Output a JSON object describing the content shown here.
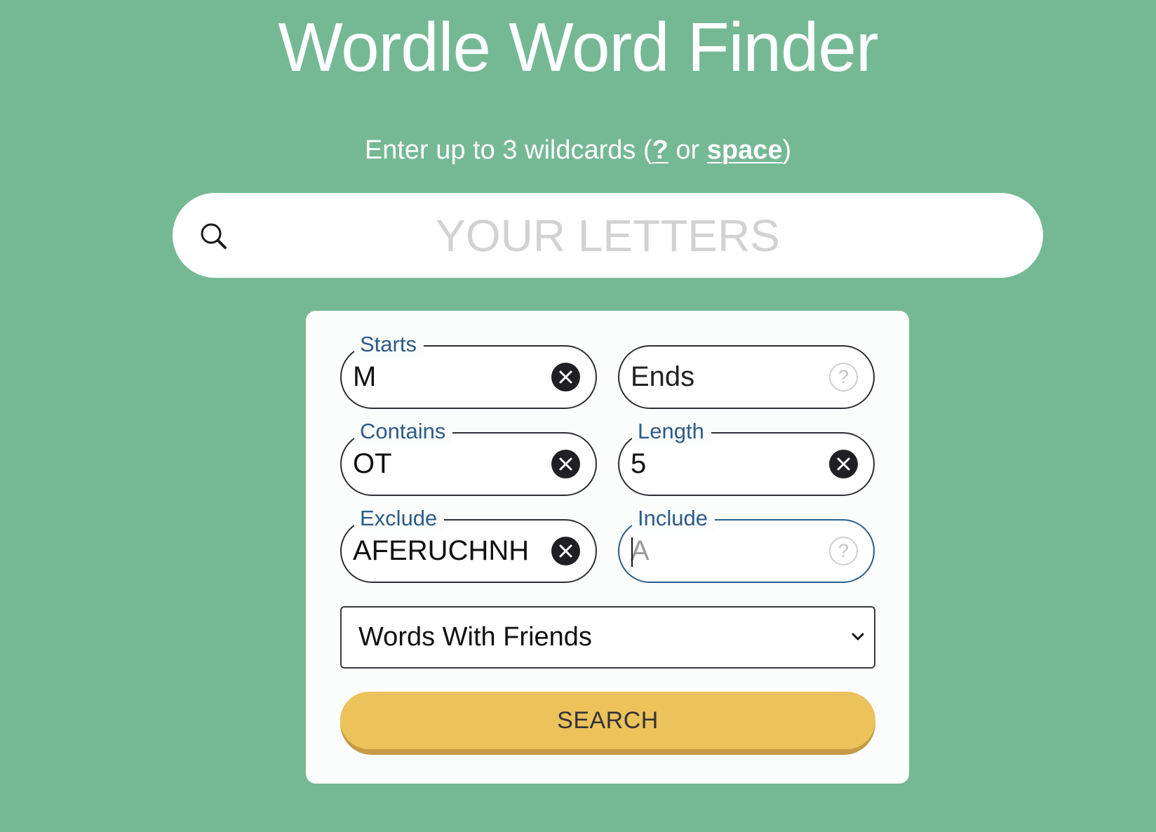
{
  "header": {
    "title": "Wordle Word Finder",
    "subtitle_prefix": "Enter up to 3 wildcards (",
    "subtitle_link_question": "?",
    "subtitle_middle": " or ",
    "subtitle_link_space": "space",
    "subtitle_suffix": ")"
  },
  "search": {
    "icon": "search-icon",
    "placeholder": "YOUR LETTERS",
    "value": ""
  },
  "filters": {
    "starts": {
      "label": "Starts",
      "value": "M",
      "placeholder": "",
      "action_icon": "clear-icon"
    },
    "ends": {
      "label": "",
      "value": "",
      "placeholder": "Ends",
      "action_icon": "help-icon"
    },
    "contains": {
      "label": "Contains",
      "value": "OT",
      "placeholder": "",
      "action_icon": "clear-icon"
    },
    "length": {
      "label": "Length",
      "value": "5",
      "placeholder": "",
      "action_icon": "clear-icon"
    },
    "exclude": {
      "label": "Exclude",
      "value": "AFERUCHNH",
      "placeholder": "",
      "action_icon": "clear-icon"
    },
    "include": {
      "label": "Include",
      "value": "",
      "placeholder": "A",
      "action_icon": "help-icon",
      "focused": true
    }
  },
  "help_glyph": "?",
  "dictionary_select": {
    "selected": "Words With Friends"
  },
  "search_button": {
    "label": "SEARCH"
  },
  "colors": {
    "background": "#75B994",
    "panel": "#FBFCFC",
    "label_blue": "#2B5C8A",
    "button_yellow": "#ECC25B",
    "button_shadow": "#C49A44",
    "placeholder_gray": "#D2D2D2"
  }
}
